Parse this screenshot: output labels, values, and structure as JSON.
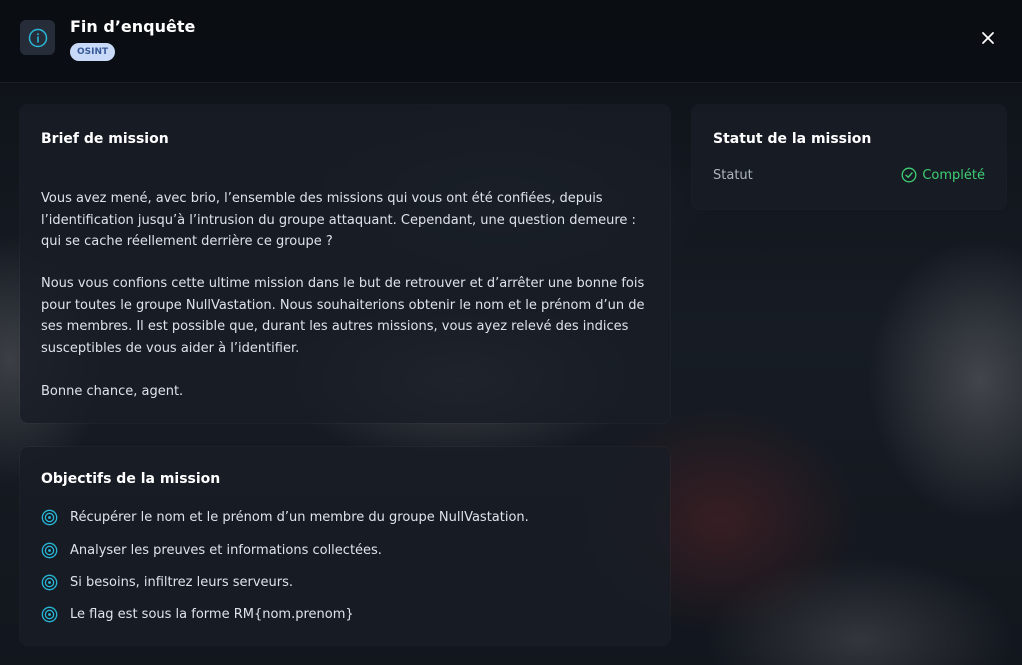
{
  "header": {
    "title": "Fin d’enquête",
    "badge": "OSINT",
    "info_icon": "info-circle-icon",
    "close_icon": "close-icon"
  },
  "brief": {
    "title": "Brief de mission",
    "paragraphs": [
      "Vous avez mené, avec brio, l’ensemble des missions qui vous ont été confiées, depuis l’identification jusqu’à l’intrusion du groupe attaquant. Cependant, une question demeure : qui se cache réellement derrière ce groupe ?",
      "Nous vous confions cette ultime mission dans le but de retrouver et d’arrêter une bonne fois pour toutes le groupe NullVastation. Nous souhaiterions obtenir le nom et le prénom d’un de ses membres. Il est possible que, durant les autres missions, vous ayez relevé des indices susceptibles de vous aider à l’identifier.",
      "Bonne chance, agent."
    ]
  },
  "objectives": {
    "title": "Objectifs de la mission",
    "icon": "target-icon",
    "items": [
      "Récupérer le nom et le prénom d’un membre du groupe NullVastation.",
      "Analyser les preuves et informations collectées.",
      "Si besoins, infiltrez leurs serveurs.",
      "Le flag est sous la forme RM{nom.prenom}"
    ]
  },
  "status": {
    "title": "Statut de la mission",
    "label": "Statut",
    "value": "Complété",
    "icon": "check-circle-icon"
  },
  "colors": {
    "accent": "#29b6d6",
    "success": "#3fcf74",
    "badge_bg": "#c9daf8",
    "badge_text": "#3a5a9a"
  }
}
